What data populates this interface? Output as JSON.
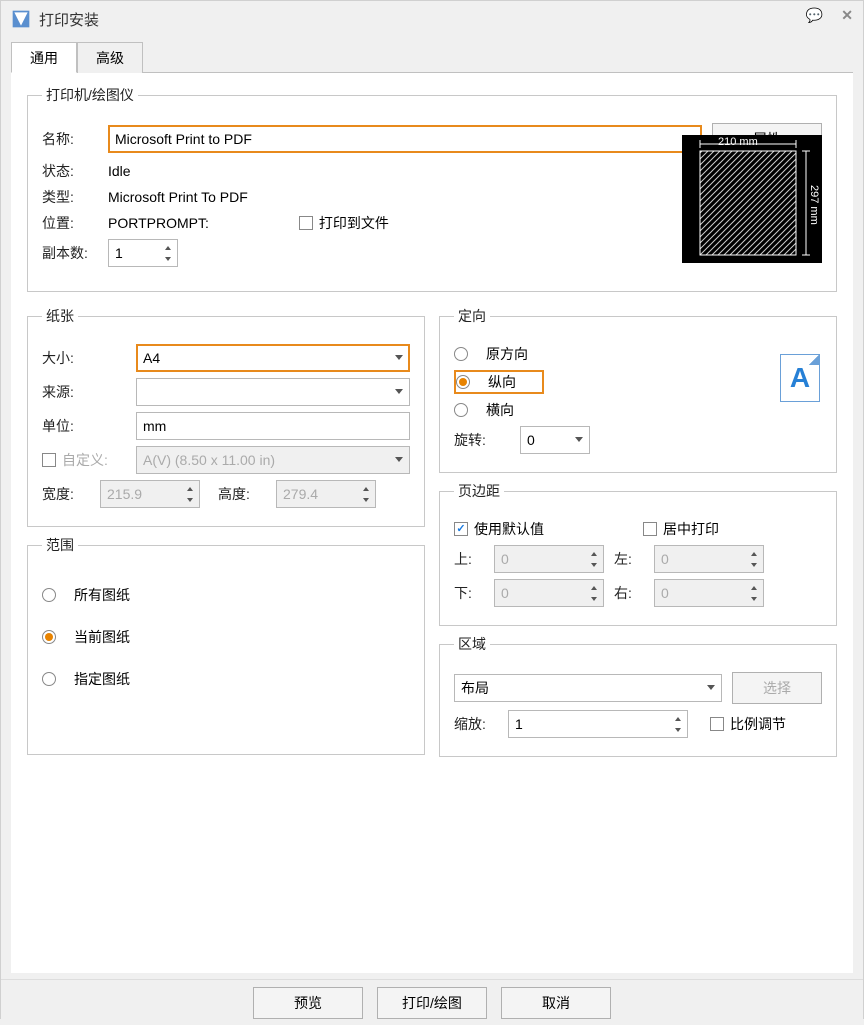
{
  "window": {
    "title": "打印安装"
  },
  "tabs": {
    "general": "通用",
    "advanced": "高级"
  },
  "printer": {
    "legend": "打印机/绘图仪",
    "name_label": "名称:",
    "name_value": "Microsoft Print to PDF",
    "properties_btn": "属性",
    "status_label": "状态:",
    "status_value": "Idle",
    "type_label": "类型:",
    "type_value": "Microsoft Print To PDF",
    "location_label": "位置:",
    "location_value": "PORTPROMPT:",
    "print_to_file_label": "打印到文件",
    "copies_label": "副本数:",
    "copies_value": "1",
    "preview_width": "210 mm",
    "preview_height": "297 mm"
  },
  "paper": {
    "legend": "纸张",
    "size_label": "大小:",
    "size_value": "A4",
    "source_label": "来源:",
    "source_value": "",
    "unit_label": "单位:",
    "unit_value": "mm",
    "custom_label": "自定义:",
    "custom_value": "A(V) (8.50 x 11.00 in)",
    "width_label": "宽度:",
    "width_value": "215.9",
    "height_label": "高度:",
    "height_value": "279.4"
  },
  "range": {
    "legend": "范围",
    "all": "所有图纸",
    "current": "当前图纸",
    "specify": "指定图纸"
  },
  "orientation": {
    "legend": "定向",
    "original": "原方向",
    "portrait": "纵向",
    "landscape": "横向",
    "rotate_label": "旋转:",
    "rotate_value": "0"
  },
  "margins": {
    "legend": "页边距",
    "use_default": "使用默认值",
    "center_print": "居中打印",
    "top_label": "上:",
    "top_value": "0",
    "left_label": "左:",
    "left_value": "0",
    "bottom_label": "下:",
    "bottom_value": "0",
    "right_label": "右:",
    "right_value": "0"
  },
  "area": {
    "legend": "区域",
    "layout_value": "布局",
    "select_btn": "选择",
    "scale_label": "缩放:",
    "scale_value": "1",
    "proportion_label": "比例调节"
  },
  "footer": {
    "preview": "预览",
    "print": "打印/绘图",
    "cancel": "取消"
  }
}
